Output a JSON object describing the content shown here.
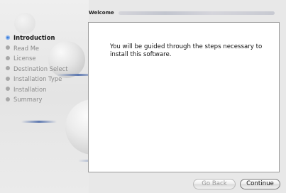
{
  "header": {
    "title": "Welcome"
  },
  "sidebar": {
    "items": [
      {
        "label": "Introduction",
        "active": true
      },
      {
        "label": "Read Me",
        "active": false
      },
      {
        "label": "License",
        "active": false
      },
      {
        "label": "Destination Select",
        "active": false
      },
      {
        "label": "Installation Type",
        "active": false
      },
      {
        "label": "Installation",
        "active": false
      },
      {
        "label": "Summary",
        "active": false
      }
    ]
  },
  "main": {
    "message": "You will be guided through the steps necessary to install this software."
  },
  "buttons": {
    "back_label": "Go Back",
    "back_enabled": false,
    "continue_label": "Continue"
  },
  "colors": {
    "active_step": "#3a7bd8",
    "inactive_step": "#a8a8a8",
    "accent_streak": "#5d78b0"
  }
}
